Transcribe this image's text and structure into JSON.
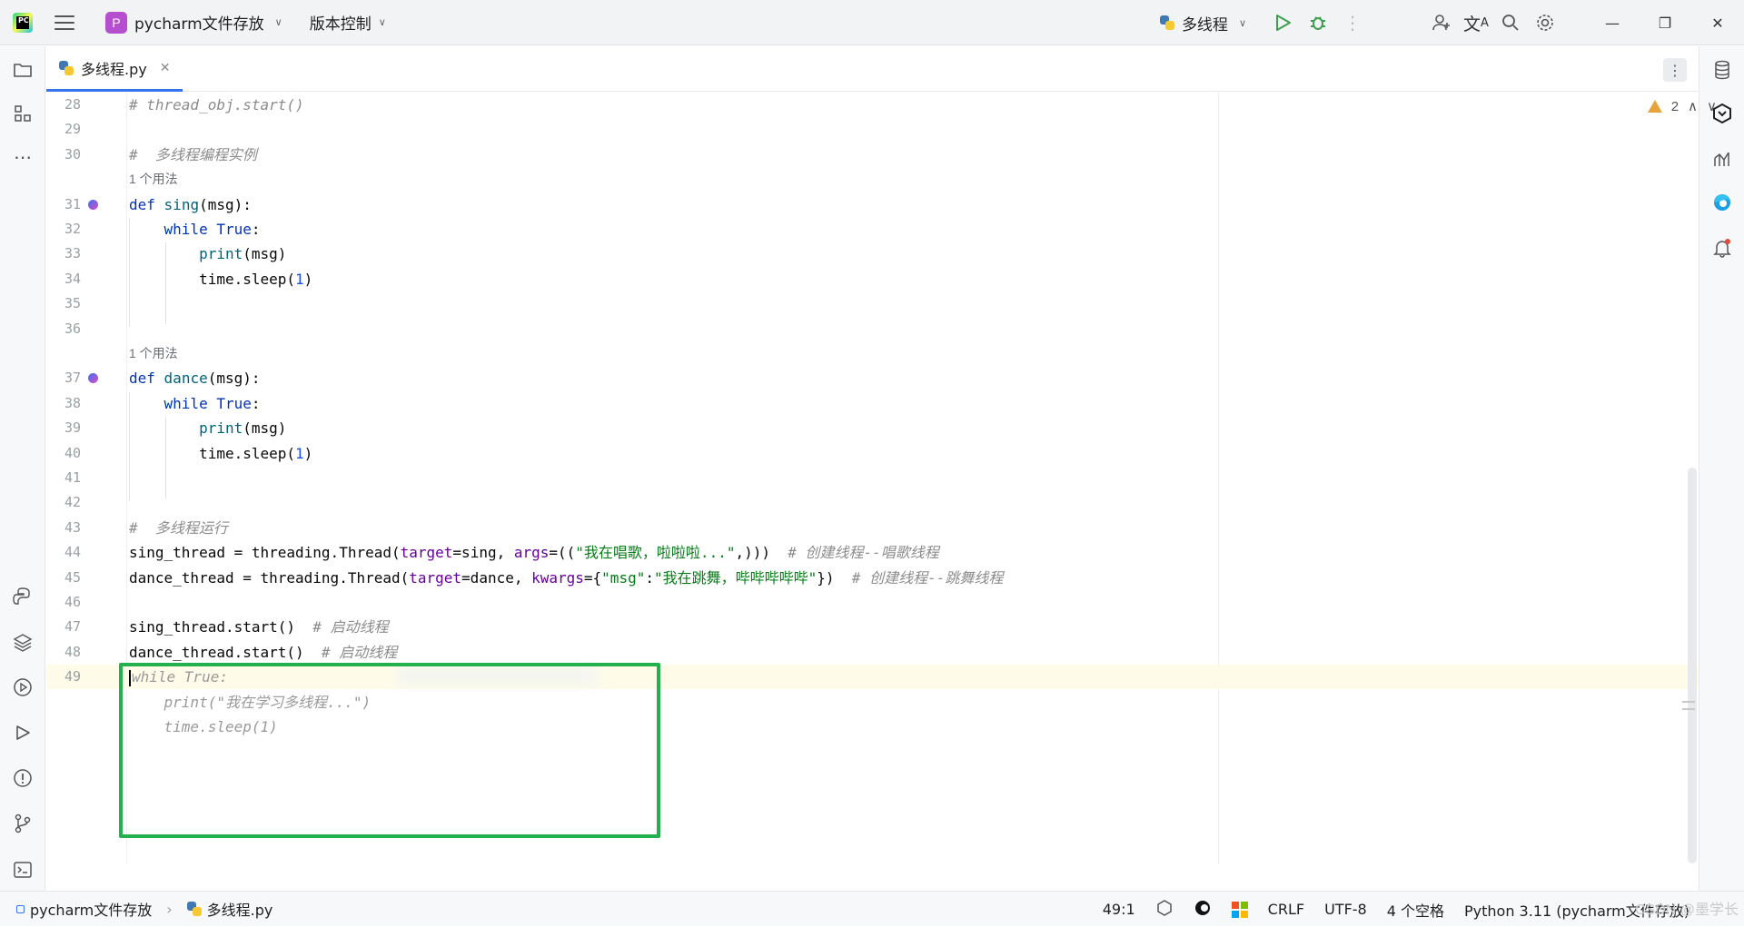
{
  "titlebar": {
    "logo_text": "PC",
    "project_badge": "P",
    "project_name": "pycharm文件存放",
    "vcs_label": "版本控制",
    "run_config": "多线程"
  },
  "tab": {
    "label": "多线程.py"
  },
  "editor": {
    "warnings_count": "2",
    "usage_hint": "1 个用法",
    "lines": [
      {
        "n": "28",
        "html": "<span class=\"cm\"># thread_obj.start()</span>"
      },
      {
        "n": "29",
        "html": ""
      },
      {
        "n": "30",
        "html": "<span class=\"cm\">#  多线程编程实例</span>"
      },
      {
        "n": "31",
        "html": "<span class=\"kw\">def</span> <span class=\"fn\">sing</span>(msg):",
        "marker": true
      },
      {
        "n": "32",
        "html": "    <span class=\"kw\">while</span> <span class=\"kw\">True</span>:"
      },
      {
        "n": "33",
        "html": "        <span class=\"fn\">print</span>(msg)"
      },
      {
        "n": "34",
        "html": "        time.sleep(<span class=\"nm\">1</span>)"
      },
      {
        "n": "35",
        "html": ""
      },
      {
        "n": "36",
        "html": ""
      },
      {
        "n": "37",
        "html": "<span class=\"kw\">def</span> <span class=\"fn\">dance</span>(msg):",
        "marker": true
      },
      {
        "n": "38",
        "html": "    <span class=\"kw\">while</span> <span class=\"kw\">True</span>:"
      },
      {
        "n": "39",
        "html": "        <span class=\"fn\">print</span>(msg)"
      },
      {
        "n": "40",
        "html": "        time.sleep(<span class=\"nm\">1</span>)"
      },
      {
        "n": "41",
        "html": ""
      },
      {
        "n": "42",
        "html": ""
      },
      {
        "n": "43",
        "html": "<span class=\"cm\">#  多线程运行</span>"
      },
      {
        "n": "44",
        "html": "sing_thread = threading.Thread(<span class=\"kwarg\">target</span>=sing, <span class=\"kwarg\">args</span>=((<span class=\"st\">\"我在唱歌，啦啦啦...\"</span>,)))  <span class=\"cm\"># 创建线程--唱歌线程</span>"
      },
      {
        "n": "45",
        "html": "dance_thread = threading.Thread(<span class=\"kwarg\">target</span>=dance, <span class=\"kwarg\">kwargs</span>={<span class=\"st\">\"msg\"</span>:<span class=\"st\">\"我在跳舞，哔哔哔哔哔\"</span>})  <span class=\"cm\"># 创建线程--跳舞线程</span>"
      },
      {
        "n": "46",
        "html": ""
      },
      {
        "n": "47",
        "html": "sing_thread.start()  <span class=\"cm\"># 启动线程</span>"
      },
      {
        "n": "48",
        "html": "dance_thread.start()  <span class=\"cm\"># 启动线程</span>"
      },
      {
        "n": "49",
        "html": "<span class=\"caret\"></span><span class=\"ghost\">while True:</span>",
        "current": true
      },
      {
        "n": "",
        "html": "    <span class=\"ghost\">print(\"我在学习多线程...\")</span>"
      },
      {
        "n": "",
        "html": "    <span class=\"ghost\">time.sleep(1)</span>"
      }
    ]
  },
  "statusbar": {
    "project": "pycharm文件存放",
    "file": "多线程.py",
    "position": "49:1",
    "line_sep": "CRLF",
    "encoding": "UTF-8",
    "indent": "4 个空格",
    "interpreter": "Python 3.11 (pycharm文件存放)",
    "watermark": "CSDN @墨学长"
  },
  "colors": {
    "accent": "#3574f0",
    "highlight_box": "#22b14c",
    "project_badge": "#b54fd0"
  }
}
